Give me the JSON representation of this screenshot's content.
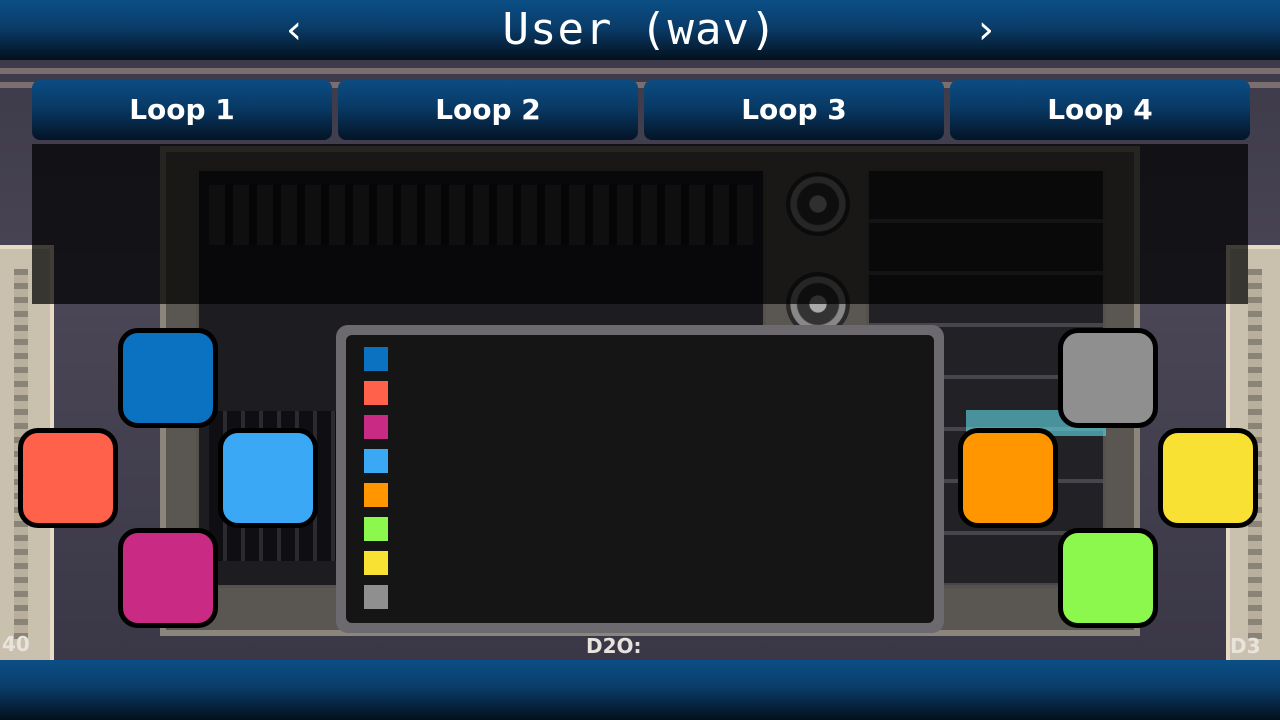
{
  "header": {
    "title": "User (wav)",
    "prev_label": "‹",
    "next_label": "›"
  },
  "tabs": [
    {
      "label": "Loop 1"
    },
    {
      "label": "Loop 2"
    },
    {
      "label": "Loop 3"
    },
    {
      "label": "Loop 4"
    }
  ],
  "background": {
    "label_left": "40",
    "label_center": "D2O:",
    "label_right": "D3"
  },
  "pads": {
    "left": {
      "top": {
        "color": "#0b72c2"
      },
      "left": {
        "color": "#ff614a"
      },
      "right": {
        "color": "#3aa8f5"
      },
      "bottom": {
        "color": "#c92a83"
      }
    },
    "right": {
      "top": {
        "color": "#8f8f8f"
      },
      "left": {
        "color": "#ff9600"
      },
      "right": {
        "color": "#f8e132"
      },
      "bottom": {
        "color": "#8cf74c"
      }
    }
  },
  "legend_swatches": [
    {
      "color": "#0b72c2"
    },
    {
      "color": "#ff614a"
    },
    {
      "color": "#c92a83"
    },
    {
      "color": "#3aa8f5"
    },
    {
      "color": "#ff9600"
    },
    {
      "color": "#8cf74c"
    },
    {
      "color": "#f8e132"
    },
    {
      "color": "#8f8f8f"
    }
  ]
}
